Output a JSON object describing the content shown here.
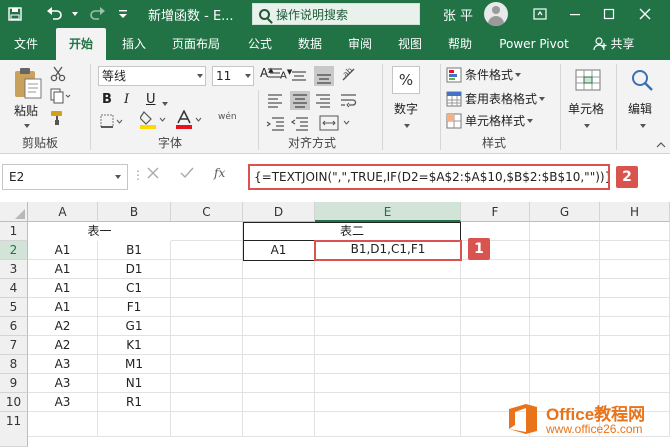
{
  "titlebar": {
    "doc_title": "新增函数 - E...",
    "search_placeholder": "操作说明搜索",
    "user_name": "张 平"
  },
  "ribbon_tabs": [
    "文件",
    "开始",
    "插入",
    "页面布局",
    "公式",
    "数据",
    "审阅",
    "视图",
    "帮助",
    "Power Pivot"
  ],
  "share_label": "共享",
  "ribbon": {
    "paste_label": "粘贴",
    "clipboard_group": "剪贴板",
    "font_name": "等线",
    "font_size": "11",
    "font_group": "字体",
    "bold": "B",
    "italic": "I",
    "underline": "U",
    "wen_label": "wén",
    "align_group": "对齐方式",
    "number_label": "数字",
    "percent_symbol": "%",
    "cond_format": "条件格式",
    "table_format": "套用表格格式",
    "cell_style": "单元格样式",
    "style_group": "样式",
    "cells_label": "单元格",
    "edit_label": "编辑"
  },
  "formula_bar": {
    "name_box": "E2",
    "fx": "fx",
    "formula": "{=TEXTJOIN(\",\",TRUE,IF(D2=$A$2:$A$10,$B$2:$B$10,\"\"))}",
    "badge": "2"
  },
  "grid": {
    "columns": [
      "A",
      "B",
      "C",
      "D",
      "E",
      "F",
      "G",
      "H"
    ],
    "rows": [
      "1",
      "2",
      "3",
      "4",
      "5",
      "6",
      "7",
      "8",
      "9",
      "10",
      "11"
    ],
    "table1_title": "表一",
    "table2_title": "表二",
    "table1": [
      [
        "A1",
        "B1"
      ],
      [
        "A1",
        "D1"
      ],
      [
        "A1",
        "C1"
      ],
      [
        "A1",
        "F1"
      ],
      [
        "A2",
        "G1"
      ],
      [
        "A2",
        "K1"
      ],
      [
        "A3",
        "M1"
      ],
      [
        "A3",
        "N1"
      ],
      [
        "A3",
        "R1"
      ]
    ],
    "d2": "A1",
    "e2": "B1,D1,C1,F1",
    "badge": "1"
  },
  "watermark": {
    "line1": "Office教程网",
    "line2": "www.office26.com"
  },
  "colors": {
    "excel_green": "#217346",
    "highlight_red": "#d9534f",
    "watermark_orange": "#e8731b"
  }
}
